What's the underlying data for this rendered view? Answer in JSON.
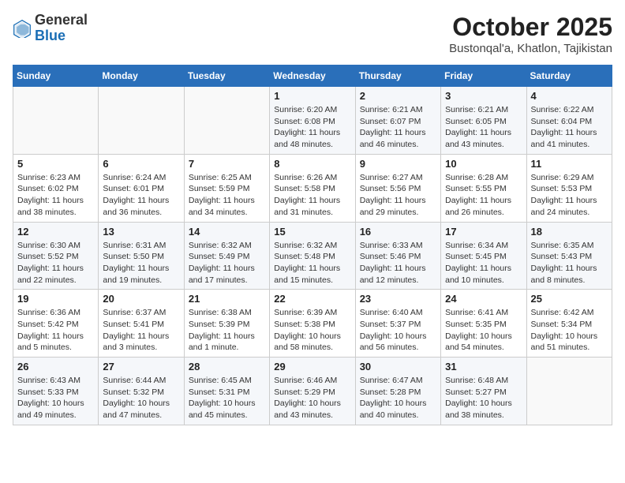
{
  "header": {
    "logo_general": "General",
    "logo_blue": "Blue",
    "month_title": "October 2025",
    "location": "Bustonqal'a, Khatlon, Tajikistan"
  },
  "days_of_week": [
    "Sunday",
    "Monday",
    "Tuesday",
    "Wednesday",
    "Thursday",
    "Friday",
    "Saturday"
  ],
  "weeks": [
    [
      {
        "day": "",
        "info": ""
      },
      {
        "day": "",
        "info": ""
      },
      {
        "day": "",
        "info": ""
      },
      {
        "day": "1",
        "info": "Sunrise: 6:20 AM\nSunset: 6:08 PM\nDaylight: 11 hours\nand 48 minutes."
      },
      {
        "day": "2",
        "info": "Sunrise: 6:21 AM\nSunset: 6:07 PM\nDaylight: 11 hours\nand 46 minutes."
      },
      {
        "day": "3",
        "info": "Sunrise: 6:21 AM\nSunset: 6:05 PM\nDaylight: 11 hours\nand 43 minutes."
      },
      {
        "day": "4",
        "info": "Sunrise: 6:22 AM\nSunset: 6:04 PM\nDaylight: 11 hours\nand 41 minutes."
      }
    ],
    [
      {
        "day": "5",
        "info": "Sunrise: 6:23 AM\nSunset: 6:02 PM\nDaylight: 11 hours\nand 38 minutes."
      },
      {
        "day": "6",
        "info": "Sunrise: 6:24 AM\nSunset: 6:01 PM\nDaylight: 11 hours\nand 36 minutes."
      },
      {
        "day": "7",
        "info": "Sunrise: 6:25 AM\nSunset: 5:59 PM\nDaylight: 11 hours\nand 34 minutes."
      },
      {
        "day": "8",
        "info": "Sunrise: 6:26 AM\nSunset: 5:58 PM\nDaylight: 11 hours\nand 31 minutes."
      },
      {
        "day": "9",
        "info": "Sunrise: 6:27 AM\nSunset: 5:56 PM\nDaylight: 11 hours\nand 29 minutes."
      },
      {
        "day": "10",
        "info": "Sunrise: 6:28 AM\nSunset: 5:55 PM\nDaylight: 11 hours\nand 26 minutes."
      },
      {
        "day": "11",
        "info": "Sunrise: 6:29 AM\nSunset: 5:53 PM\nDaylight: 11 hours\nand 24 minutes."
      }
    ],
    [
      {
        "day": "12",
        "info": "Sunrise: 6:30 AM\nSunset: 5:52 PM\nDaylight: 11 hours\nand 22 minutes."
      },
      {
        "day": "13",
        "info": "Sunrise: 6:31 AM\nSunset: 5:50 PM\nDaylight: 11 hours\nand 19 minutes."
      },
      {
        "day": "14",
        "info": "Sunrise: 6:32 AM\nSunset: 5:49 PM\nDaylight: 11 hours\nand 17 minutes."
      },
      {
        "day": "15",
        "info": "Sunrise: 6:32 AM\nSunset: 5:48 PM\nDaylight: 11 hours\nand 15 minutes."
      },
      {
        "day": "16",
        "info": "Sunrise: 6:33 AM\nSunset: 5:46 PM\nDaylight: 11 hours\nand 12 minutes."
      },
      {
        "day": "17",
        "info": "Sunrise: 6:34 AM\nSunset: 5:45 PM\nDaylight: 11 hours\nand 10 minutes."
      },
      {
        "day": "18",
        "info": "Sunrise: 6:35 AM\nSunset: 5:43 PM\nDaylight: 11 hours\nand 8 minutes."
      }
    ],
    [
      {
        "day": "19",
        "info": "Sunrise: 6:36 AM\nSunset: 5:42 PM\nDaylight: 11 hours\nand 5 minutes."
      },
      {
        "day": "20",
        "info": "Sunrise: 6:37 AM\nSunset: 5:41 PM\nDaylight: 11 hours\nand 3 minutes."
      },
      {
        "day": "21",
        "info": "Sunrise: 6:38 AM\nSunset: 5:39 PM\nDaylight: 11 hours\nand 1 minute."
      },
      {
        "day": "22",
        "info": "Sunrise: 6:39 AM\nSunset: 5:38 PM\nDaylight: 10 hours\nand 58 minutes."
      },
      {
        "day": "23",
        "info": "Sunrise: 6:40 AM\nSunset: 5:37 PM\nDaylight: 10 hours\nand 56 minutes."
      },
      {
        "day": "24",
        "info": "Sunrise: 6:41 AM\nSunset: 5:35 PM\nDaylight: 10 hours\nand 54 minutes."
      },
      {
        "day": "25",
        "info": "Sunrise: 6:42 AM\nSunset: 5:34 PM\nDaylight: 10 hours\nand 51 minutes."
      }
    ],
    [
      {
        "day": "26",
        "info": "Sunrise: 6:43 AM\nSunset: 5:33 PM\nDaylight: 10 hours\nand 49 minutes."
      },
      {
        "day": "27",
        "info": "Sunrise: 6:44 AM\nSunset: 5:32 PM\nDaylight: 10 hours\nand 47 minutes."
      },
      {
        "day": "28",
        "info": "Sunrise: 6:45 AM\nSunset: 5:31 PM\nDaylight: 10 hours\nand 45 minutes."
      },
      {
        "day": "29",
        "info": "Sunrise: 6:46 AM\nSunset: 5:29 PM\nDaylight: 10 hours\nand 43 minutes."
      },
      {
        "day": "30",
        "info": "Sunrise: 6:47 AM\nSunset: 5:28 PM\nDaylight: 10 hours\nand 40 minutes."
      },
      {
        "day": "31",
        "info": "Sunrise: 6:48 AM\nSunset: 5:27 PM\nDaylight: 10 hours\nand 38 minutes."
      },
      {
        "day": "",
        "info": ""
      }
    ]
  ]
}
